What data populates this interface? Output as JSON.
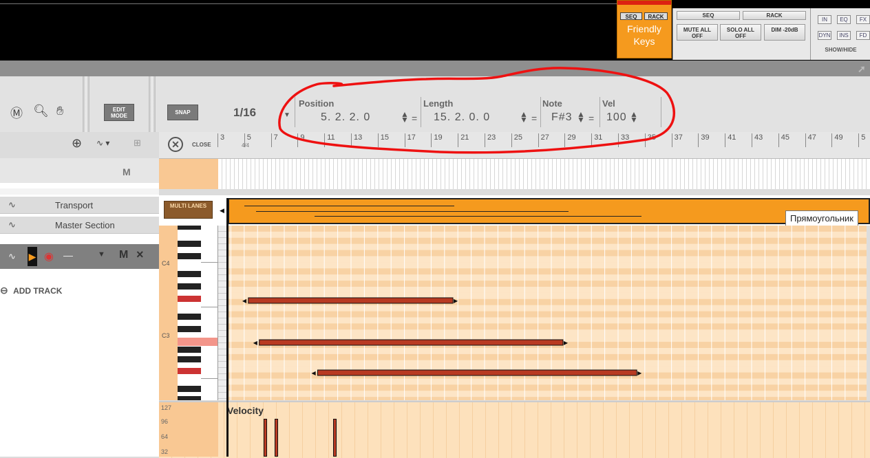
{
  "device": {
    "seq_label": "SEQ",
    "rack_label": "RACK",
    "name_line1": "Friendly",
    "name_line2": "Keys"
  },
  "mixer": {
    "seq": "SEQ",
    "rack": "RACK",
    "mute": "MUTE ALL OFF",
    "solo": "SOLO ALL OFF",
    "dim": "DIM -20dB"
  },
  "inserts": {
    "buttons": [
      "IN",
      "EQ",
      "FX",
      "DYN",
      "INS",
      "FD"
    ],
    "show_hide": "SHOW/HIDE"
  },
  "toolbar": {
    "edit_mode": "EDIT MODE",
    "snap": "SNAP",
    "snap_value": "1/16",
    "position_label": "Position",
    "position_value": "5.  2.  2.   0",
    "length_label": "Length",
    "length_value": "15.  2.  0.   0",
    "note_label": "Note",
    "note_value": "F#3",
    "vel_label": "Vel",
    "vel_value": "100",
    "eq_sign": "="
  },
  "tracks": {
    "master_m": "M",
    "items": [
      {
        "name": "Transport"
      },
      {
        "name": "Master Section"
      }
    ],
    "inst_m": "M",
    "inst_x": "×",
    "add_track": "ADD TRACK"
  },
  "ruler": {
    "close": "CLOSE",
    "time_sig": "4/4",
    "bars": [
      "3",
      "5",
      "7",
      "9",
      "11",
      "13",
      "15",
      "17",
      "19",
      "21",
      "23",
      "25",
      "27",
      "29",
      "31",
      "33",
      "35",
      "37",
      "39",
      "41",
      "43",
      "45",
      "47",
      "49",
      "5"
    ]
  },
  "lanes": {
    "multi_lanes": "MULTI LANES",
    "tooltip": "Прямоугольник"
  },
  "piano": {
    "c4": "C4",
    "c3": "C3"
  },
  "velocity": {
    "title": "Velocity",
    "ticks": [
      "127",
      "96",
      "64",
      "32"
    ]
  },
  "notes": [
    {
      "start_bar": 5.31,
      "end_bar": 20.63,
      "pitch": "F#3"
    },
    {
      "start_bar": 6.13,
      "end_bar": 28.87,
      "pitch": "D3"
    },
    {
      "start_bar": 10.5,
      "end_bar": 34.4,
      "pitch": "A#2"
    }
  ]
}
